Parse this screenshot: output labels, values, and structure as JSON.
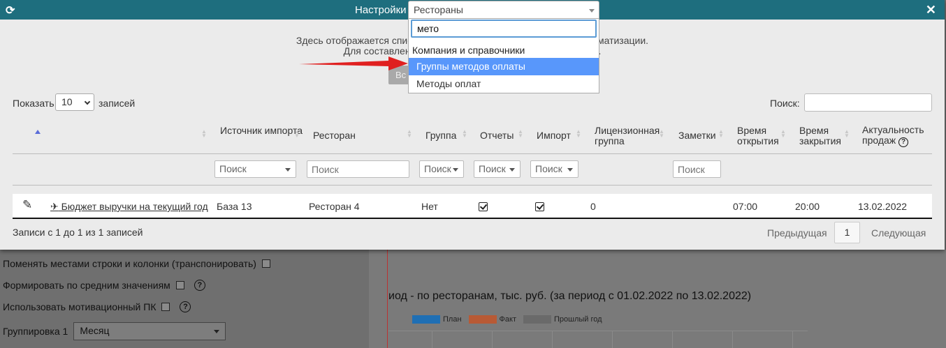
{
  "modal": {
    "title": "Настройки",
    "info_line1": "Здесь отображается список р                                                      автоматизации.",
    "info_line2": "Для составления бюд                                              очек",
    "info_button": "Вс"
  },
  "table_controls": {
    "show_label": "Показать",
    "page_length": "10",
    "records_label": "записей",
    "search_label": "Поиск:",
    "search_value": ""
  },
  "columns": [
    {
      "key": "source",
      "label": "Источник импорта"
    },
    {
      "key": "restaurant",
      "label": "Ресторан"
    },
    {
      "key": "group",
      "label": "Группа"
    },
    {
      "key": "reports",
      "label": "Отчеты"
    },
    {
      "key": "import",
      "label": "Импорт"
    },
    {
      "key": "license",
      "label": "Лицензионная группа"
    },
    {
      "key": "notes",
      "label": "Заметки"
    },
    {
      "key": "open_time",
      "label": "Время открытия"
    },
    {
      "key": "close_time",
      "label": "Время закрытия"
    },
    {
      "key": "actuality",
      "label": "Актуальность продаж"
    }
  ],
  "filters": {
    "placeholder": "Поиск"
  },
  "rows": [
    {
      "name": " Бюджет выручки на текущий год",
      "source": "База 13",
      "restaurant": "Ресторан 4",
      "group": "Нет",
      "reports": true,
      "import": true,
      "license": "0",
      "notes": "",
      "open_time": "07:00",
      "close_time": "20:00",
      "actuality": "13.02.2022"
    }
  ],
  "footer": {
    "info": "Записи с 1 до 1 из 1 записей",
    "prev": "Предыдущая",
    "current_page": "1",
    "next": "Следующая"
  },
  "dropdown": {
    "selected": "Рестораны",
    "search_value": "мето",
    "group_label": "Компания и справочники",
    "options": [
      {
        "label": "Группы методов оплаты",
        "highlighted": true
      },
      {
        "label": "Методы оплат",
        "highlighted": false
      }
    ]
  },
  "background": {
    "option_transpose": "Поменять местами строки и колонки (транспонировать)",
    "option_average": "Формировать по средним значениям",
    "option_motivation": "Использовать мотивационный ПК",
    "grouping_label": "Группировка 1",
    "grouping_value": "Месяц",
    "chart_title": "иод - по ресторанам, тыс. руб. (за период с 01.02.2022 по 13.02.2022)",
    "legend": [
      {
        "name": "План",
        "color": "#1f6fb4"
      },
      {
        "name": "Факт",
        "color": "#b85a35"
      },
      {
        "name": "Прошлый год",
        "color": "#6a6a6a"
      }
    ]
  },
  "colors": {
    "header": "#1e6e7e",
    "highlight": "#5897fb",
    "arrow": "#e02020"
  }
}
